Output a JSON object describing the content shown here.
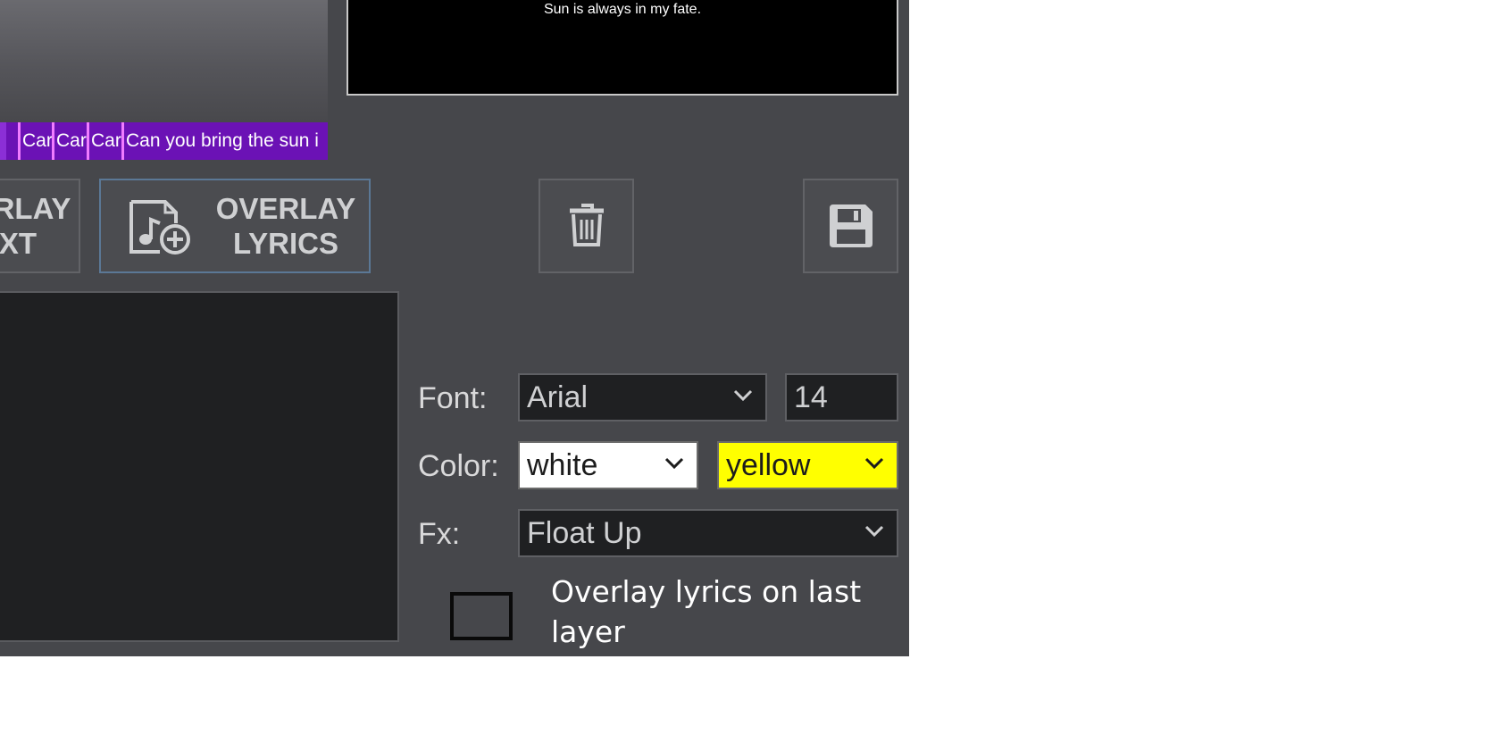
{
  "preview": {
    "text": "Sun is always in my fate."
  },
  "lyric_track": {
    "segments": [
      "Car",
      "Car",
      "Car",
      "Can you bring the sun i"
    ],
    "color": "#6b12b5"
  },
  "toolbar": {
    "overlay_text_label_line1": "RLAY",
    "overlay_text_label_line2": "XT",
    "overlay_lyrics_label_line1": "OVERLAY",
    "overlay_lyrics_label_line2": "LYRICS",
    "overlay_lyrics_icon": "music-note-add-icon",
    "delete_icon": "trash-icon",
    "save_icon": "floppy-disk-icon"
  },
  "settings": {
    "font_label": "Font:",
    "font_value": "Arial",
    "font_size": "14",
    "color_label": "Color:",
    "color_primary": "white",
    "color_secondary": "yellow",
    "fx_label": "Fx:",
    "fx_value": "Float Up",
    "overlay_last_layer_label": "Overlay lyrics on last layer",
    "overlay_last_layer_checked": false
  }
}
